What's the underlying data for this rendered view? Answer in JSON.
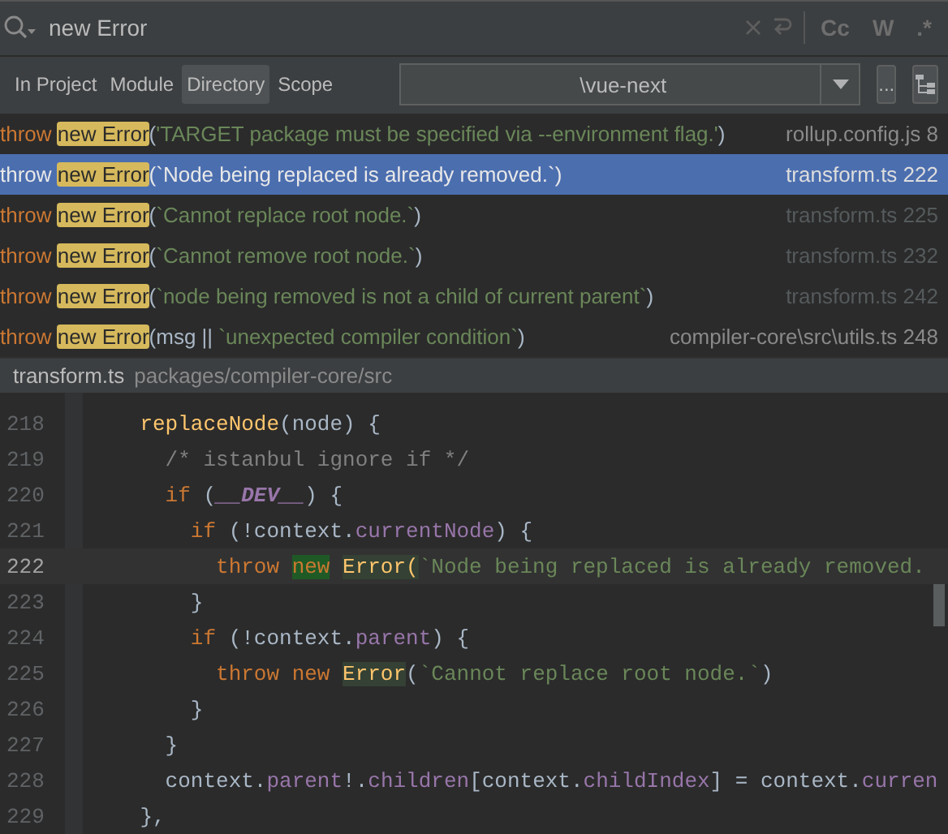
{
  "search": {
    "value": "new Error",
    "toggles": [
      {
        "label": "Cc",
        "on": false
      },
      {
        "label": "W",
        "on": false
      },
      {
        "label": ".*",
        "on": false
      }
    ]
  },
  "scopes": [
    {
      "label": "In Project",
      "selected": false
    },
    {
      "label": "Module",
      "selected": false
    },
    {
      "label": "Directory",
      "selected": true
    },
    {
      "label": "Scope",
      "selected": false
    }
  ],
  "directory": {
    "value": "\\vue-next",
    "browse_button": "..."
  },
  "results": [
    {
      "keyword": "throw",
      "match": "new Error",
      "args": [
        {
          "text": "(",
          "kind": "plain"
        },
        {
          "text": "'TARGET package must be specified via --environment flag.'",
          "kind": "string"
        },
        {
          "text": ")",
          "kind": "plain"
        }
      ],
      "location": "rollup.config.js 8",
      "selected": false,
      "dimmed": false
    },
    {
      "keyword": "throw",
      "match": "new Error",
      "args": [
        {
          "text": "(",
          "kind": "plain"
        },
        {
          "text": "`Node being replaced is already removed.`",
          "kind": "string"
        },
        {
          "text": ")",
          "kind": "plain"
        }
      ],
      "location": "transform.ts 222",
      "selected": true,
      "dimmed": false
    },
    {
      "keyword": "throw",
      "match": "new Error",
      "args": [
        {
          "text": "(",
          "kind": "plain"
        },
        {
          "text": "`Cannot replace root node.`",
          "kind": "string"
        },
        {
          "text": ")",
          "kind": "plain"
        }
      ],
      "location": "transform.ts 225",
      "selected": false,
      "dimmed": true
    },
    {
      "keyword": "throw",
      "match": "new Error",
      "args": [
        {
          "text": "(",
          "kind": "plain"
        },
        {
          "text": "`Cannot remove root node.`",
          "kind": "string"
        },
        {
          "text": ")",
          "kind": "plain"
        }
      ],
      "location": "transform.ts 232",
      "selected": false,
      "dimmed": true
    },
    {
      "keyword": "throw",
      "match": "new Error",
      "args": [
        {
          "text": "(",
          "kind": "plain"
        },
        {
          "text": "`node being removed is not a child of current parent`",
          "kind": "string"
        },
        {
          "text": ")",
          "kind": "plain"
        }
      ],
      "location": "transform.ts 242",
      "selected": false,
      "dimmed": true
    },
    {
      "keyword": "throw",
      "match": "new Error",
      "args": [
        {
          "text": "(msg || ",
          "kind": "plain"
        },
        {
          "text": "`unexpected compiler condition`",
          "kind": "string"
        },
        {
          "text": ")",
          "kind": "plain"
        }
      ],
      "location": "compiler-core\\src\\utils.ts 248",
      "selected": false,
      "dimmed": false
    }
  ],
  "preview": {
    "file": "transform.ts",
    "path": "packages/compiler-core/src",
    "lines": [
      {
        "number": "218",
        "current": false,
        "tokens": [
          {
            "text": "    replaceNode",
            "kind": "function"
          },
          {
            "text": "(node) {",
            "kind": "plain"
          }
        ]
      },
      {
        "number": "219",
        "current": false,
        "tokens": [
          {
            "text": "      /* istanbul ignore if */",
            "kind": "comment"
          }
        ]
      },
      {
        "number": "220",
        "current": false,
        "tokens": [
          {
            "text": "      if",
            "kind": "keyword"
          },
          {
            "text": " (",
            "kind": "plain"
          },
          {
            "text": "__DEV__",
            "kind": "constant"
          },
          {
            "text": ") {",
            "kind": "plain"
          }
        ]
      },
      {
        "number": "221",
        "current": false,
        "tokens": [
          {
            "text": "        if",
            "kind": "keyword"
          },
          {
            "text": " (!context.",
            "kind": "plain"
          },
          {
            "text": "currentNode",
            "kind": "property"
          },
          {
            "text": ") {",
            "kind": "plain"
          }
        ]
      },
      {
        "number": "222",
        "current": true,
        "tokens": [
          {
            "text": "          throw ",
            "kind": "keyword"
          },
          {
            "text": "new",
            "kind": "keyword-match"
          },
          {
            "text": "Error(",
            "kind": "function-usage"
          },
          {
            "text": "`Node being replaced is already removed.",
            "kind": "string"
          }
        ]
      },
      {
        "number": "223",
        "current": false,
        "tokens": [
          {
            "text": "        }",
            "kind": "plain"
          }
        ]
      },
      {
        "number": "224",
        "current": false,
        "tokens": [
          {
            "text": "        if",
            "kind": "keyword"
          },
          {
            "text": " (!context.",
            "kind": "plain"
          },
          {
            "text": "parent",
            "kind": "property"
          },
          {
            "text": ") {",
            "kind": "plain"
          }
        ]
      },
      {
        "number": "225",
        "current": false,
        "tokens": [
          {
            "text": "          throw new ",
            "kind": "keyword"
          },
          {
            "text": "Error",
            "kind": "function-usage"
          },
          {
            "text": "(",
            "kind": "plain"
          },
          {
            "text": "`Cannot replace root node.`",
            "kind": "string"
          },
          {
            "text": ")",
            "kind": "plain"
          }
        ]
      },
      {
        "number": "226",
        "current": false,
        "tokens": [
          {
            "text": "        }",
            "kind": "plain"
          }
        ]
      },
      {
        "number": "227",
        "current": false,
        "tokens": [
          {
            "text": "      }",
            "kind": "plain"
          }
        ]
      },
      {
        "number": "228",
        "current": false,
        "tokens": [
          {
            "text": "      context.",
            "kind": "plain"
          },
          {
            "text": "parent",
            "kind": "property"
          },
          {
            "text": "!.",
            "kind": "plain"
          },
          {
            "text": "children",
            "kind": "property"
          },
          {
            "text": "[context.",
            "kind": "plain"
          },
          {
            "text": "childIndex",
            "kind": "property"
          },
          {
            "text": "] = context.",
            "kind": "plain"
          },
          {
            "text": "curren",
            "kind": "property"
          }
        ]
      },
      {
        "number": "229",
        "current": false,
        "tokens": [
          {
            "text": "    },",
            "kind": "plain"
          }
        ]
      }
    ]
  }
}
